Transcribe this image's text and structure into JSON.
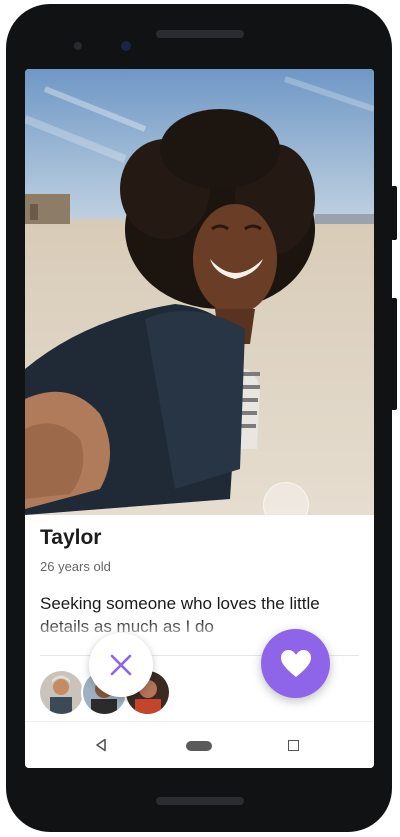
{
  "profile": {
    "name": "Taylor",
    "age": "26 years old",
    "bio": "Seeking someone who loves the little details as much as I do"
  },
  "actions": {
    "reject_icon": "close-icon",
    "like_icon": "heart-icon"
  },
  "matches": {
    "avatars": [
      "avatar-1",
      "avatar-2",
      "avatar-3"
    ]
  },
  "navbar": {
    "items": [
      "back-icon",
      "home-icon",
      "recents-icon"
    ]
  },
  "colors": {
    "accent": "#8e65e8",
    "text": "#1c1c1c",
    "muted": "#666666"
  }
}
